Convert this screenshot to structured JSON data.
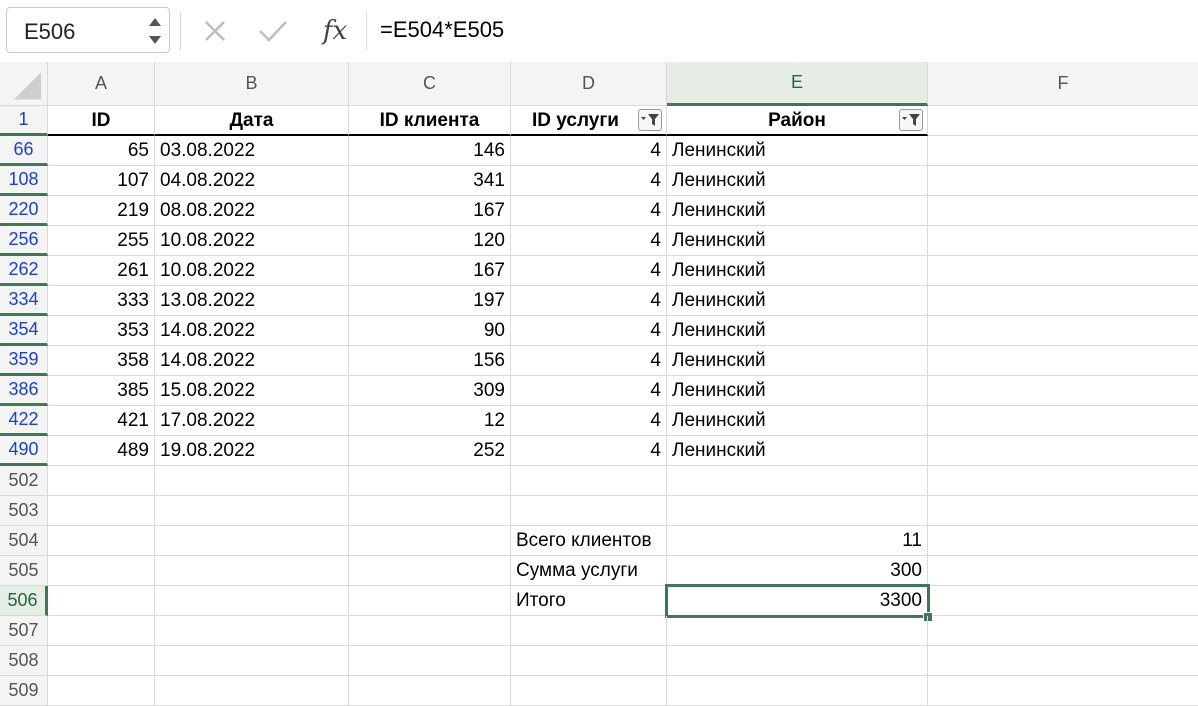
{
  "formula_bar": {
    "name_box": "E506",
    "fx_label": "fx",
    "formula": "=E504*E505"
  },
  "columns": [
    "A",
    "B",
    "C",
    "D",
    "E",
    "F"
  ],
  "header_row": {
    "row_number": "1",
    "A": "ID",
    "B": "Дата",
    "C": "ID клиента",
    "D": "ID услуги",
    "E": "Район"
  },
  "rows": [
    {
      "num": "66",
      "A": "65",
      "B": "03.08.2022",
      "C": "146",
      "D": "4",
      "E": "Ленинский"
    },
    {
      "num": "108",
      "A": "107",
      "B": "04.08.2022",
      "C": "341",
      "D": "4",
      "E": "Ленинский"
    },
    {
      "num": "220",
      "A": "219",
      "B": "08.08.2022",
      "C": "167",
      "D": "4",
      "E": "Ленинский"
    },
    {
      "num": "256",
      "A": "255",
      "B": "10.08.2022",
      "C": "120",
      "D": "4",
      "E": "Ленинский"
    },
    {
      "num": "262",
      "A": "261",
      "B": "10.08.2022",
      "C": "167",
      "D": "4",
      "E": "Ленинский"
    },
    {
      "num": "334",
      "A": "333",
      "B": "13.08.2022",
      "C": "197",
      "D": "4",
      "E": "Ленинский"
    },
    {
      "num": "354",
      "A": "353",
      "B": "14.08.2022",
      "C": "90",
      "D": "4",
      "E": "Ленинский"
    },
    {
      "num": "359",
      "A": "358",
      "B": "14.08.2022",
      "C": "156",
      "D": "4",
      "E": "Ленинский"
    },
    {
      "num": "386",
      "A": "385",
      "B": "15.08.2022",
      "C": "309",
      "D": "4",
      "E": "Ленинский"
    },
    {
      "num": "422",
      "A": "421",
      "B": "17.08.2022",
      "C": "12",
      "D": "4",
      "E": "Ленинский"
    },
    {
      "num": "490",
      "A": "489",
      "B": "19.08.2022",
      "C": "252",
      "D": "4",
      "E": "Ленинский"
    }
  ],
  "empty_rows": [
    "502",
    "503"
  ],
  "summary_rows": [
    {
      "num": "504",
      "label": "Всего клиентов",
      "value": "11"
    },
    {
      "num": "505",
      "label": "Сумма услуги",
      "value": "300"
    },
    {
      "num": "506",
      "label": "Итого",
      "value": "3300"
    }
  ],
  "trailing_rows": [
    "507",
    "508",
    "509"
  ],
  "colors": {
    "selection": "#3b7a55",
    "filtered_row_number": "#1a3fd1"
  }
}
